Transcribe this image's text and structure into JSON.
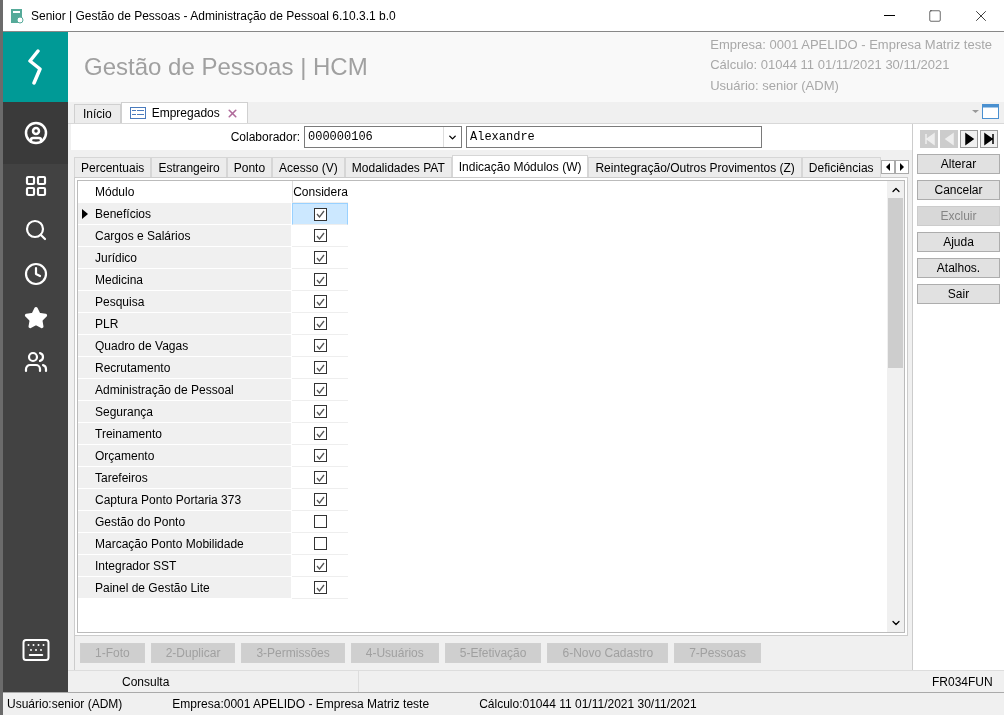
{
  "window": {
    "title": "Senior | Gestão de Pessoas - Administração de Pessoal 6.10.3.1 b.0"
  },
  "header": {
    "app_title": "Gestão de Pessoas | HCM",
    "info": [
      "Empresa: 0001  APELIDO - Empresa Matriz teste",
      "Cálculo: 01044  11  01/11/2021  30/11/2021",
      "Usuário: senior (ADM)"
    ]
  },
  "sidebar": {
    "items": [
      {
        "kind": "user",
        "selected": true
      },
      {
        "kind": "apps",
        "selected": false
      },
      {
        "kind": "search",
        "selected": false
      },
      {
        "kind": "history",
        "selected": false
      },
      {
        "kind": "favorites",
        "selected": false
      },
      {
        "kind": "team",
        "selected": false
      }
    ]
  },
  "doc_tabs": [
    {
      "label": "Início",
      "selected": false,
      "closable": false
    },
    {
      "label": "Empregados",
      "selected": true,
      "closable": true
    }
  ],
  "collaborator": {
    "label": "Colaborador:",
    "code": "000000106",
    "name": "Alexandre"
  },
  "tabs": [
    {
      "label": "Percentuais",
      "selected": false
    },
    {
      "label": "Estrangeiro",
      "selected": false
    },
    {
      "label": "Ponto",
      "selected": false
    },
    {
      "label": "Acesso (V)",
      "selected": false
    },
    {
      "label": "Modalidades PAT",
      "selected": false
    },
    {
      "label": "Indicação Módulos (W)",
      "selected": true
    },
    {
      "label": "Reintegração/Outros Provimentos (Z)",
      "selected": false
    },
    {
      "label": "Deficiências",
      "selected": false
    }
  ],
  "table": {
    "columns": [
      "Módulo",
      "Considera"
    ],
    "rows": [
      {
        "module": "Benefícios",
        "checked": true,
        "selected": true
      },
      {
        "module": "Cargos e Salários",
        "checked": true,
        "selected": false
      },
      {
        "module": "Jurídico",
        "checked": true,
        "selected": false
      },
      {
        "module": "Medicina",
        "checked": true,
        "selected": false
      },
      {
        "module": "Pesquisa",
        "checked": true,
        "selected": false
      },
      {
        "module": "PLR",
        "checked": true,
        "selected": false
      },
      {
        "module": "Quadro de Vagas",
        "checked": true,
        "selected": false
      },
      {
        "module": "Recrutamento",
        "checked": true,
        "selected": false
      },
      {
        "module": "Administração de Pessoal",
        "checked": true,
        "selected": false
      },
      {
        "module": "Segurança",
        "checked": true,
        "selected": false
      },
      {
        "module": "Treinamento",
        "checked": true,
        "selected": false
      },
      {
        "module": "Orçamento",
        "checked": true,
        "selected": false
      },
      {
        "module": "Tarefeiros",
        "checked": true,
        "selected": false
      },
      {
        "module": "Captura Ponto Portaria 373",
        "checked": true,
        "selected": false
      },
      {
        "module": "Gestão do Ponto",
        "checked": false,
        "selected": false
      },
      {
        "module": "Marcação Ponto Mobilidade",
        "checked": false,
        "selected": false
      },
      {
        "module": "Integrador SST",
        "checked": true,
        "selected": false
      },
      {
        "module": "Painel de Gestão Lite",
        "checked": true,
        "selected": false
      }
    ]
  },
  "nav_buttons": [
    {
      "kind": "first",
      "disabled": true
    },
    {
      "kind": "previous",
      "disabled": true
    },
    {
      "kind": "next",
      "disabled": false
    },
    {
      "kind": "last",
      "disabled": false
    }
  ],
  "actions": [
    {
      "label": "Alterar",
      "disabled": false
    },
    {
      "label": "Cancelar",
      "disabled": false
    },
    {
      "label": "Excluir",
      "disabled": true
    },
    {
      "label": "Ajuda",
      "disabled": false
    },
    {
      "label": "Atalhos.",
      "disabled": false
    },
    {
      "label": "Sair",
      "disabled": false
    }
  ],
  "bottom_buttons": [
    {
      "label": "1-Foto",
      "disabled": true
    },
    {
      "label": "2-Duplicar",
      "disabled": true
    },
    {
      "label": "3-Permissões",
      "disabled": true
    },
    {
      "label": "4-Usuários",
      "disabled": true
    },
    {
      "label": "5-Efetivação",
      "disabled": true
    },
    {
      "label": "6-Novo Cadastro",
      "disabled": true
    },
    {
      "label": "7-Pessoas",
      "disabled": true
    }
  ],
  "mode_bar": {
    "mode": "Consulta",
    "form_code": "FR034FUN"
  },
  "status_bar": [
    "Usuário:senior (ADM)",
    "Empresa:0001  APELIDO - Empresa Matriz teste",
    "Cálculo:01044  11  01/11/2021  30/11/2021"
  ]
}
